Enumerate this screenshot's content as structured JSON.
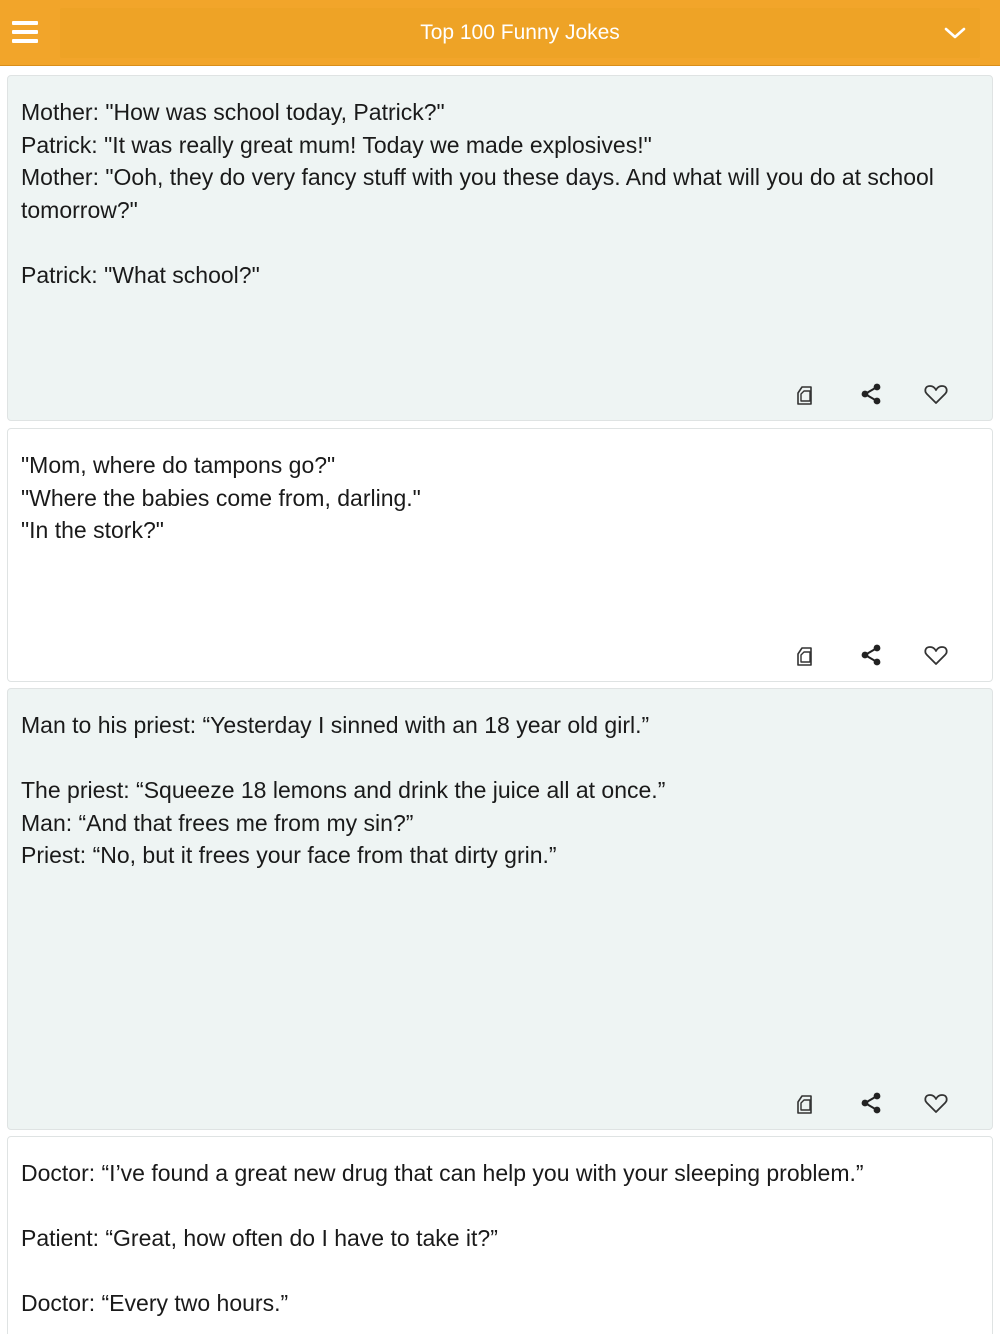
{
  "header": {
    "title": "Top 100 Funny Jokes",
    "menu_icon": "hamburger-menu-icon",
    "dropdown_icon": "chevron-down-icon",
    "bar_color": "#f2a52a"
  },
  "jokes": [
    {
      "text": "Mother: \"How was school today, Patrick?\"\nPatrick: \"It was really great mum! Today we made explosives!\"\nMother: \"Ooh, they do very fancy stuff with you these days. And what will you do at school tomorrow?\"\n\nPatrick: \"What school?\""
    },
    {
      "text": "\"Mom, where do tampons go?\"\n\"Where the babies come from, darling.\"\n\"In the stork?\""
    },
    {
      "text": "Man to his priest: “Yesterday I sinned with an 18 year old girl.”\n\nThe priest: “Squeeze 18 lemons and drink the juice all at once.”\nMan: “And that frees me from my sin?”\nPriest: “No, but it frees your face from that dirty grin.”"
    },
    {
      "text": "Doctor: “I’ve found a great new drug that can help you with your sleeping problem.”\n\nPatient: “Great, how often do I have to take it?”\n\nDoctor: “Every two hours.”"
    }
  ],
  "actions": {
    "copy_icon": "copy-icon",
    "share_icon": "share-icon",
    "favorite_icon": "heart-icon"
  }
}
